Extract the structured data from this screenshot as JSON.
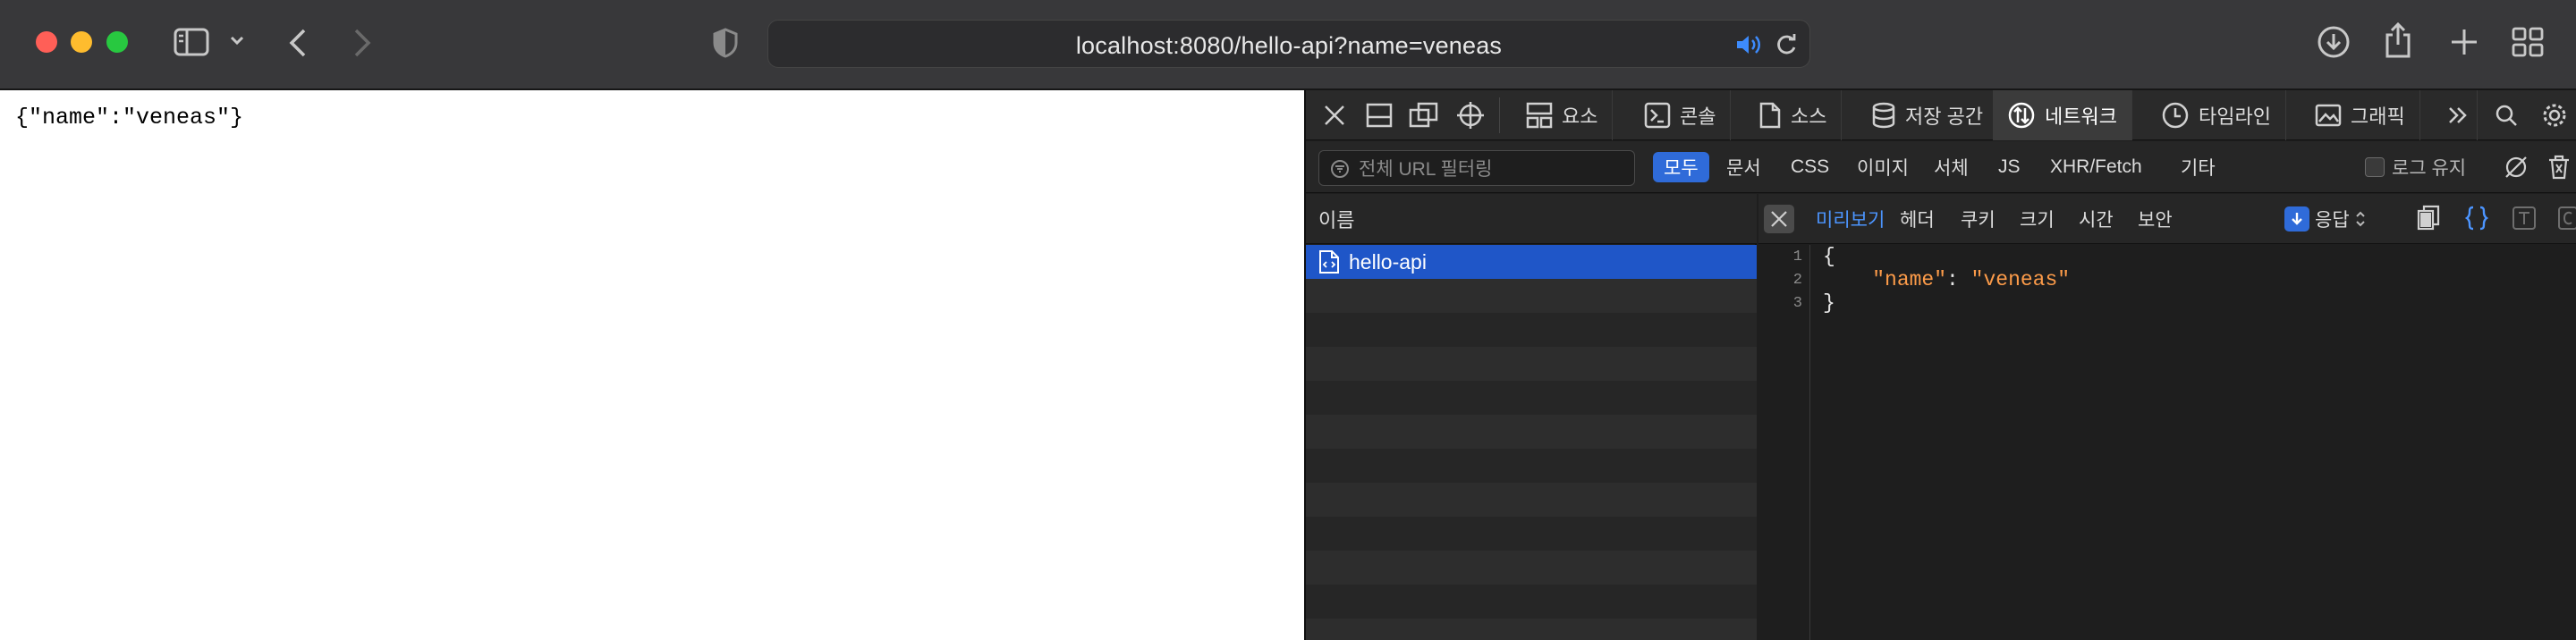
{
  "browser": {
    "url": "localhost:8080/hello-api?name=veneas"
  },
  "page": {
    "raw_body": "{\"name\":\"veneas\"}"
  },
  "devtools": {
    "tabs": [
      {
        "label": "요소",
        "icon": "elements-icon"
      },
      {
        "label": "콘솔",
        "icon": "console-icon"
      },
      {
        "label": "소스",
        "icon": "sources-icon"
      },
      {
        "label": "저장 공간",
        "icon": "storage-icon"
      },
      {
        "label": "네트워크",
        "icon": "network-icon",
        "active": true
      },
      {
        "label": "타임라인",
        "icon": "timeline-icon"
      },
      {
        "label": "그래픽",
        "icon": "graphics-icon"
      }
    ],
    "filter": {
      "placeholder": "전체 URL 필터링",
      "types": [
        "모두",
        "문서",
        "CSS",
        "이미지",
        "서체",
        "JS",
        "XHR/Fetch",
        "기타"
      ],
      "active_type": "모두",
      "preserve_log": "로그 유지"
    },
    "requests": {
      "column_name": "이름",
      "items": [
        {
          "name": "hello-api",
          "selected": true
        }
      ]
    },
    "preview": {
      "tabs": [
        "미리보기",
        "헤더",
        "쿠키",
        "크기",
        "시간",
        "보안"
      ],
      "active_tab": "미리보기",
      "response_selector": "응답",
      "code_lines": [
        {
          "num": "1",
          "text": "{"
        },
        {
          "num": "2",
          "key": "\"name\"",
          "value": "\"veneas\""
        },
        {
          "num": "3",
          "text": "}"
        }
      ]
    },
    "colors": {
      "accent": "#2f6bd9",
      "selected_row": "#1f56c8",
      "json_string": "#fc9b49"
    }
  }
}
